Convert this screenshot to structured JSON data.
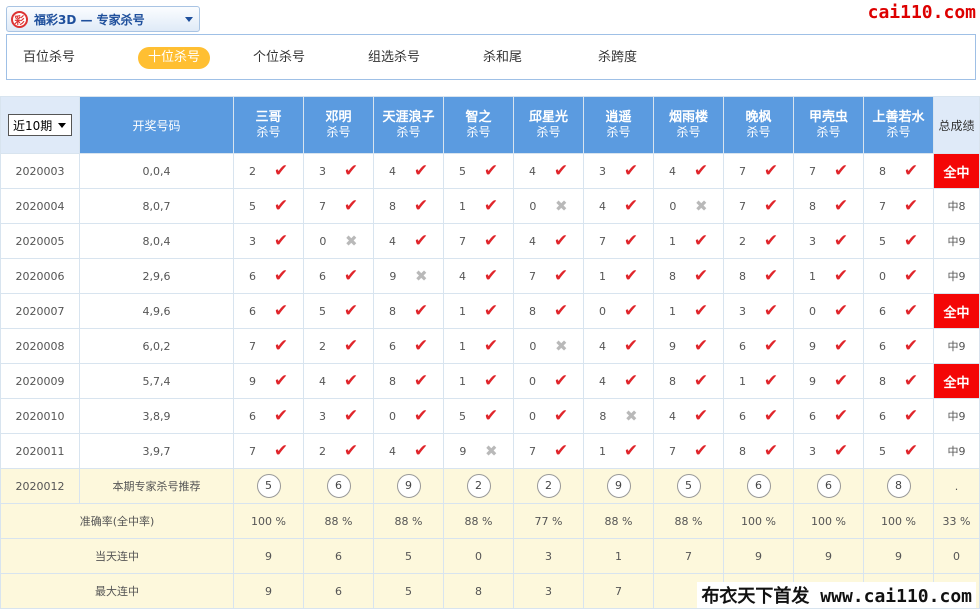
{
  "topbar": {
    "logo_glyph": "彩",
    "title": "福彩3D — 专家杀号"
  },
  "site_logo": "cai110.com",
  "tabs": [
    {
      "label": "百位杀号",
      "active": false
    },
    {
      "label": "十位杀号",
      "active": true
    },
    {
      "label": "个位杀号",
      "active": false
    },
    {
      "label": "组选杀号",
      "active": false
    },
    {
      "label": "杀和尾",
      "active": false
    },
    {
      "label": "杀跨度",
      "active": false
    }
  ],
  "header": {
    "period_select": "近10期",
    "draw_col": "开奖号码",
    "total_col": "总成绩",
    "experts": [
      {
        "name": "三哥",
        "sub": "杀号"
      },
      {
        "name": "邓明",
        "sub": "杀号"
      },
      {
        "name": "天涯浪子",
        "sub": "杀号"
      },
      {
        "name": "智之",
        "sub": "杀号"
      },
      {
        "name": "邱星光",
        "sub": "杀号"
      },
      {
        "name": "逍遥",
        "sub": "杀号"
      },
      {
        "name": "烟雨楼",
        "sub": "杀号"
      },
      {
        "name": "晚枫",
        "sub": "杀号"
      },
      {
        "name": "甲壳虫",
        "sub": "杀号"
      },
      {
        "name": "上善若水",
        "sub": "杀号"
      }
    ]
  },
  "rows": [
    {
      "period": "2020003",
      "draw": "0,0,4",
      "picks": [
        [
          "2",
          1
        ],
        [
          "3",
          1
        ],
        [
          "4",
          1
        ],
        [
          "5",
          1
        ],
        [
          "4",
          1
        ],
        [
          "3",
          1
        ],
        [
          "4",
          1
        ],
        [
          "7",
          1
        ],
        [
          "7",
          1
        ],
        [
          "8",
          1
        ]
      ],
      "total": "全中",
      "win": true
    },
    {
      "period": "2020004",
      "draw": "8,0,7",
      "picks": [
        [
          "5",
          1
        ],
        [
          "7",
          1
        ],
        [
          "8",
          1
        ],
        [
          "1",
          1
        ],
        [
          "0",
          0
        ],
        [
          "4",
          1
        ],
        [
          "0",
          0
        ],
        [
          "7",
          1
        ],
        [
          "8",
          1
        ],
        [
          "7",
          1
        ]
      ],
      "total": "中8",
      "win": false
    },
    {
      "period": "2020005",
      "draw": "8,0,4",
      "picks": [
        [
          "3",
          1
        ],
        [
          "0",
          0
        ],
        [
          "4",
          1
        ],
        [
          "7",
          1
        ],
        [
          "4",
          1
        ],
        [
          "7",
          1
        ],
        [
          "1",
          1
        ],
        [
          "2",
          1
        ],
        [
          "3",
          1
        ],
        [
          "5",
          1
        ]
      ],
      "total": "中9",
      "win": false
    },
    {
      "period": "2020006",
      "draw": "2,9,6",
      "picks": [
        [
          "6",
          1
        ],
        [
          "6",
          1
        ],
        [
          "9",
          0
        ],
        [
          "4",
          1
        ],
        [
          "7",
          1
        ],
        [
          "1",
          1
        ],
        [
          "8",
          1
        ],
        [
          "8",
          1
        ],
        [
          "1",
          1
        ],
        [
          "0",
          1
        ]
      ],
      "total": "中9",
      "win": false
    },
    {
      "period": "2020007",
      "draw": "4,9,6",
      "picks": [
        [
          "6",
          1
        ],
        [
          "5",
          1
        ],
        [
          "8",
          1
        ],
        [
          "1",
          1
        ],
        [
          "8",
          1
        ],
        [
          "0",
          1
        ],
        [
          "1",
          1
        ],
        [
          "3",
          1
        ],
        [
          "0",
          1
        ],
        [
          "6",
          1
        ]
      ],
      "total": "全中",
      "win": true
    },
    {
      "period": "2020008",
      "draw": "6,0,2",
      "picks": [
        [
          "7",
          1
        ],
        [
          "2",
          1
        ],
        [
          "6",
          1
        ],
        [
          "1",
          1
        ],
        [
          "0",
          0
        ],
        [
          "4",
          1
        ],
        [
          "9",
          1
        ],
        [
          "6",
          1
        ],
        [
          "9",
          1
        ],
        [
          "6",
          1
        ]
      ],
      "total": "中9",
      "win": false
    },
    {
      "period": "2020009",
      "draw": "5,7,4",
      "picks": [
        [
          "9",
          1
        ],
        [
          "4",
          1
        ],
        [
          "8",
          1
        ],
        [
          "1",
          1
        ],
        [
          "0",
          1
        ],
        [
          "4",
          1
        ],
        [
          "8",
          1
        ],
        [
          "1",
          1
        ],
        [
          "9",
          1
        ],
        [
          "8",
          1
        ]
      ],
      "total": "全中",
      "win": true
    },
    {
      "period": "2020010",
      "draw": "3,8,9",
      "picks": [
        [
          "6",
          1
        ],
        [
          "3",
          1
        ],
        [
          "0",
          1
        ],
        [
          "5",
          1
        ],
        [
          "0",
          1
        ],
        [
          "8",
          0
        ],
        [
          "4",
          1
        ],
        [
          "6",
          1
        ],
        [
          "6",
          1
        ],
        [
          "6",
          1
        ]
      ],
      "total": "中9",
      "win": false
    },
    {
      "period": "2020011",
      "draw": "3,9,7",
      "picks": [
        [
          "7",
          1
        ],
        [
          "2",
          1
        ],
        [
          "4",
          1
        ],
        [
          "9",
          0
        ],
        [
          "7",
          1
        ],
        [
          "1",
          1
        ],
        [
          "7",
          1
        ],
        [
          "8",
          1
        ],
        [
          "3",
          1
        ],
        [
          "5",
          1
        ]
      ],
      "total": "中9",
      "win": false
    }
  ],
  "recommend": {
    "period": "2020012",
    "label": "本期专家杀号推荐",
    "numbers": [
      "5",
      "6",
      "9",
      "2",
      "2",
      "9",
      "5",
      "6",
      "6",
      "8"
    ],
    "total": "."
  },
  "stats": [
    {
      "label": "准确率(全中率)",
      "values": [
        "100 %",
        "88 %",
        "88 %",
        "88 %",
        "77 %",
        "88 %",
        "88 %",
        "100 %",
        "100 %",
        "100 %"
      ],
      "total": "33 %"
    },
    {
      "label": "当天连中",
      "values": [
        "9",
        "6",
        "5",
        "0",
        "3",
        "1",
        "7",
        "9",
        "9",
        "9"
      ],
      "total": "0"
    },
    {
      "label": "最大连中",
      "values": [
        "9",
        "6",
        "5",
        "8",
        "3",
        "7",
        "",
        "",
        "",
        ""
      ],
      "total": ""
    }
  ],
  "watermark": "布衣天下首发 www.cai110.com"
}
